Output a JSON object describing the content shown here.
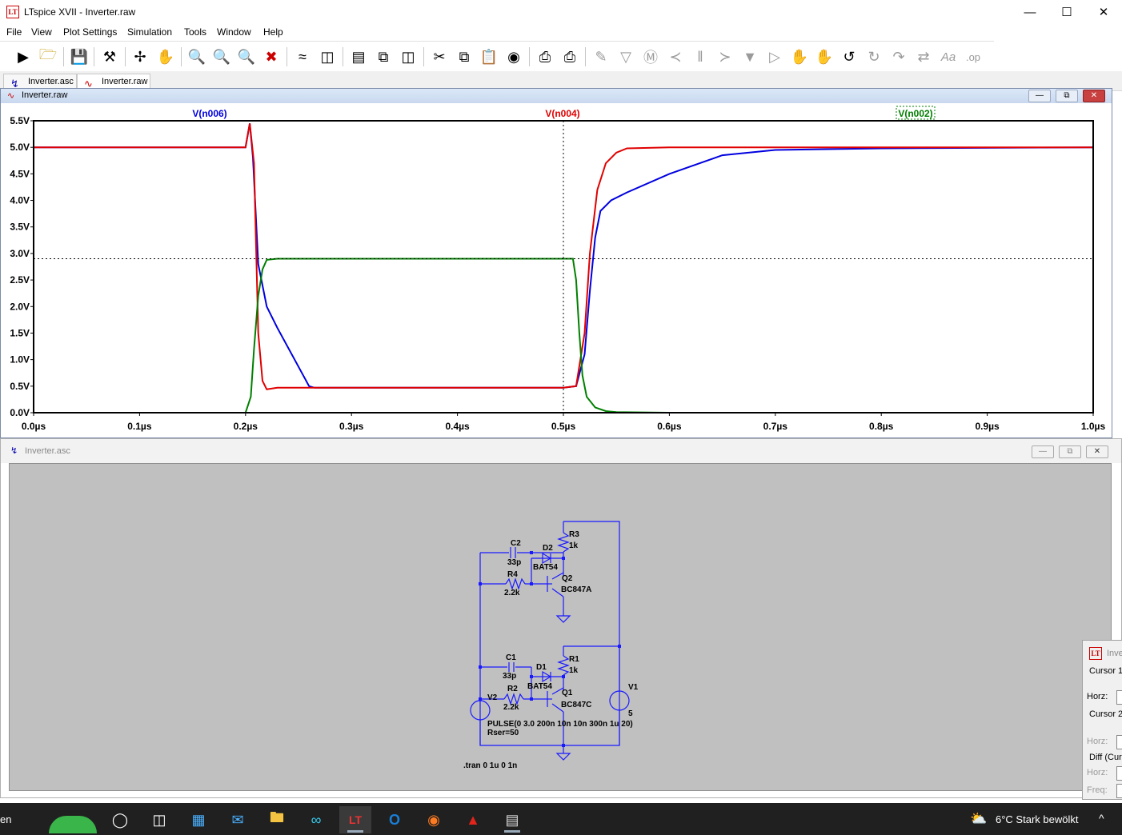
{
  "window": {
    "title": "LTspice XVII - Inverter.raw",
    "app_icon": "ltspice-logo-icon",
    "controls": [
      "minimize-icon",
      "maximize-icon",
      "close-icon"
    ]
  },
  "menu": [
    "File",
    "View",
    "Plot Settings",
    "Simulation",
    "Tools",
    "Window",
    "Help"
  ],
  "toolbar": {
    "icons": [
      "run-icon",
      "open-icon",
      "save-icon",
      "control-panel-icon",
      "halt-icon",
      "pan-hand-icon",
      "zoom-in-icon",
      "zoom-area-icon",
      "zoom-out-icon",
      "zoom-fit-icon",
      "autorange-icon",
      "autorange-y-icon",
      "tile-horizontal-icon",
      "cascade-icon",
      "tile-vertical-icon",
      "cut-icon",
      "copy-icon",
      "paste-icon",
      "find-icon",
      "print-setup-icon",
      "print-icon",
      "wire-icon",
      "ground-icon",
      "label-icon",
      "resistor-icon",
      "capacitor-icon",
      "inductor-icon",
      "diode-icon",
      "component-icon",
      "move-icon",
      "drag-icon",
      "undo-icon",
      "redo-icon",
      "rotate-icon",
      "mirror-icon",
      "text-icon",
      "spice-directive-icon"
    ]
  },
  "tabs": [
    {
      "label": "Inverter.asc",
      "icon": "schematic-icon",
      "active": false
    },
    {
      "label": "Inverter.raw",
      "icon": "waveform-icon",
      "active": true
    }
  ],
  "plot_window": {
    "title": "Inverter.raw",
    "traces": [
      {
        "name": "V(n006)",
        "color": "#0000e0"
      },
      {
        "name": "V(n004)",
        "color": "#e00000"
      },
      {
        "name": "V(n002)",
        "color": "#008000"
      }
    ]
  },
  "chart_data": {
    "type": "line",
    "xlabel": "",
    "ylabel": "",
    "xlim": [
      0,
      1.0
    ],
    "ylim": [
      0,
      5.5
    ],
    "x_ticks": [
      "0.0µs",
      "0.1µs",
      "0.2µs",
      "0.3µs",
      "0.4µs",
      "0.5µs",
      "0.6µs",
      "0.7µs",
      "0.8µs",
      "0.9µs",
      "1.0µs"
    ],
    "y_ticks": [
      "0.0V",
      "0.5V",
      "1.0V",
      "1.5V",
      "2.0V",
      "2.5V",
      "3.0V",
      "3.5V",
      "4.0V",
      "4.5V",
      "5.0V",
      "5.5V"
    ],
    "cursor": {
      "x": 0.5,
      "y": 2.9
    },
    "series": [
      {
        "name": "V(n006)",
        "color": "#0000e0",
        "x": [
          0,
          0.2,
          0.204,
          0.207,
          0.212,
          0.22,
          0.23,
          0.26,
          0.265,
          0.5,
          0.512,
          0.52,
          0.525,
          0.53,
          0.535,
          0.545,
          0.56,
          0.6,
          0.65,
          0.7,
          0.8,
          1.0
        ],
        "y": [
          5.0,
          5.0,
          5.45,
          4.8,
          2.8,
          2.0,
          1.6,
          0.5,
          0.47,
          0.47,
          0.5,
          1.1,
          2.3,
          3.3,
          3.8,
          4.0,
          4.15,
          4.5,
          4.85,
          4.95,
          4.98,
          5.0
        ]
      },
      {
        "name": "V(n004)",
        "color": "#e00000",
        "x": [
          0,
          0.2,
          0.204,
          0.208,
          0.212,
          0.216,
          0.22,
          0.23,
          0.26,
          0.5,
          0.512,
          0.52,
          0.525,
          0.532,
          0.54,
          0.55,
          0.56,
          0.6,
          1.0
        ],
        "y": [
          5.0,
          5.0,
          5.45,
          4.7,
          1.5,
          0.6,
          0.44,
          0.47,
          0.47,
          0.47,
          0.5,
          1.5,
          3.0,
          4.2,
          4.7,
          4.9,
          4.98,
          5.0,
          5.0
        ]
      },
      {
        "name": "V(n002)",
        "color": "#008000",
        "x": [
          0,
          0.2,
          0.205,
          0.208,
          0.212,
          0.216,
          0.22,
          0.23,
          0.5,
          0.509,
          0.512,
          0.515,
          0.518,
          0.522,
          0.53,
          0.54,
          0.55,
          0.6,
          1.0
        ],
        "y": [
          0.0,
          0.0,
          0.3,
          1.2,
          2.2,
          2.7,
          2.88,
          2.9,
          2.9,
          2.9,
          2.5,
          1.5,
          0.7,
          0.3,
          0.1,
          0.03,
          0.01,
          0.0,
          0.0
        ]
      }
    ]
  },
  "schematic_window": {
    "title": "Inverter.asc",
    "labels": {
      "r3": "R3",
      "r3v": "1k",
      "c2": "C2",
      "c2v": "33p",
      "d2": "D2",
      "d2v": "BAT54",
      "r4": "R4",
      "r4v": "2.2k",
      "q2": "Q2",
      "q2v": "BC847A",
      "r1": "R1",
      "r1v": "1k",
      "c1": "C1",
      "c1v": "33p",
      "d1": "D1",
      "d1v": "BAT54",
      "r2": "R2",
      "r2v": "2.2k",
      "q1": "Q1",
      "q1v": "BC847C",
      "v1": "V1",
      "v1v": "5",
      "v2": "V2",
      "pulse": "PULSE(0 3.0 200n 10n 10n 300n 1u 20)",
      "rser": "Rser=50",
      "tran": ".tran 0 1u 0 1n"
    }
  },
  "cursor_panel": {
    "title": "Inve",
    "cursor1": "Cursor 1",
    "horz1": "Horz:",
    "cursor2": "Cursor 2",
    "horz2": "Horz:",
    "diff": "Diff (Curs",
    "horz3": "Horz:",
    "freq": "Freq:"
  },
  "taskbar": {
    "search_text": "en",
    "icons": [
      "widgets-icon",
      "start-circle-icon",
      "task-view-icon",
      "store-icon",
      "mail-icon",
      "file-explorer-icon",
      "webex-icon",
      "ltspice-icon",
      "outlook-icon",
      "firefox-icon",
      "acrobat-icon",
      "photos-icon"
    ],
    "weather": "6°C  Stark bewölkt",
    "tray_chevron": "^"
  }
}
